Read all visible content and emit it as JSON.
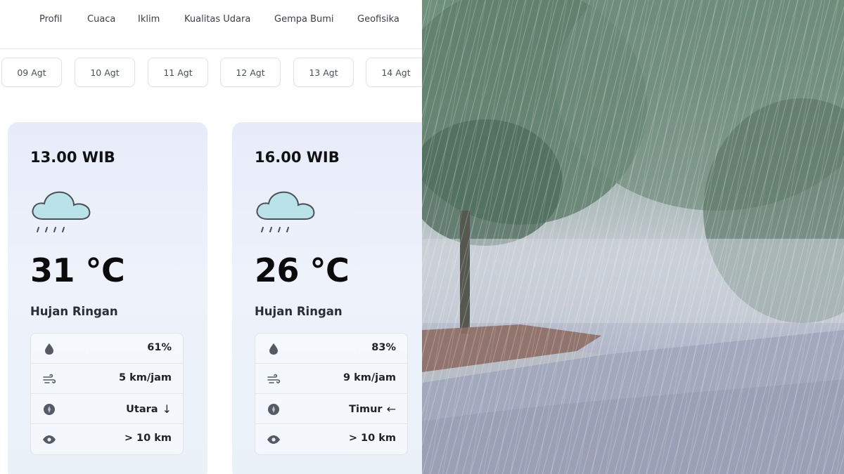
{
  "nav": {
    "items": [
      "Profil",
      "Cuaca",
      "Iklim",
      "Kualitas Udara",
      "Gempa Bumi",
      "Geofisika"
    ]
  },
  "dates": [
    "09 Agt",
    "10 Agt",
    "11 Agt",
    "12 Agt",
    "13 Agt",
    "14 Agt"
  ],
  "forecasts": [
    {
      "time": "13.00 WIB",
      "icon": "cloud-rain-icon",
      "temperature": "31 °C",
      "condition": "Hujan Ringan",
      "humidity": "61%",
      "wind_speed": "5 km/jam",
      "wind_direction": "Utara",
      "wind_arrow": "↓",
      "visibility": "> 10 km"
    },
    {
      "time": "16.00 WIB",
      "icon": "cloud-rain-icon",
      "temperature": "26 °C",
      "condition": "Hujan Ringan",
      "humidity": "83%",
      "wind_speed": "9 km/jam",
      "wind_direction": "Timur",
      "wind_arrow": "←",
      "visibility": "> 10 km"
    }
  ],
  "colors": {
    "card_bg": "#e8ecf9",
    "cloud_fill": "#b9e3e8",
    "icon_gray": "#555a64"
  }
}
